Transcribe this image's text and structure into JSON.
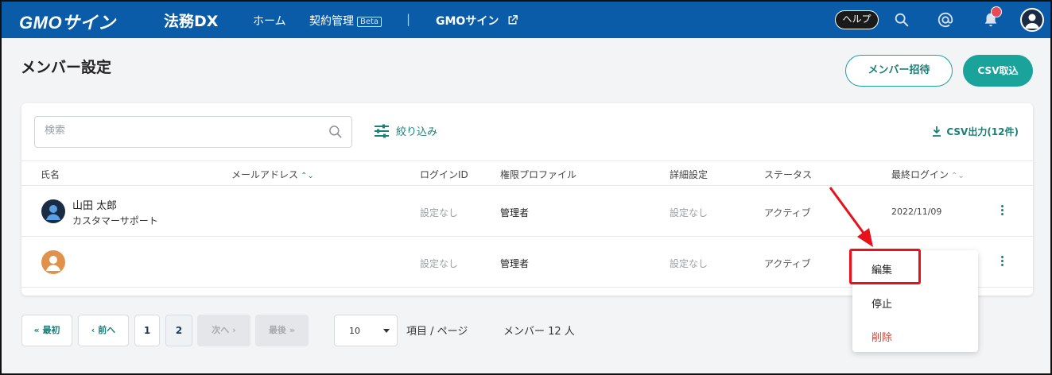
{
  "header": {
    "brand": "GMOサイン",
    "product": "法務DX",
    "nav": [
      {
        "label": "ホーム"
      },
      {
        "label": "契約管理",
        "badge": "Beta"
      },
      {
        "label": "GMOサイン"
      }
    ],
    "separator": "|",
    "help_label": "ヘルプ",
    "icons": [
      "search-icon",
      "at-icon",
      "bell-icon",
      "user-avatar-icon",
      "external-link-icon"
    ],
    "colors": {
      "bar": "#0a5ca8",
      "notification": "#e64b5a"
    }
  },
  "page": {
    "title": "メンバー設定",
    "invite_button": "メンバー招待",
    "csv_import_button": "CSV取込",
    "accent": "#1aa39a"
  },
  "toolbar": {
    "search_placeholder": "検索",
    "filter_label": "絞り込み",
    "csv_export_label": "CSV出力(12件)"
  },
  "table": {
    "columns": [
      "氏名",
      "メールアドレス",
      "ログインID",
      "権限プロファイル",
      "詳細設定",
      "ステータス",
      "最終ログイン"
    ],
    "rows": [
      {
        "name": "山田 太郎",
        "department": "カスタマーサポート",
        "email": "",
        "login_id": "設定なし",
        "profile": "管理者",
        "detail": "設定なし",
        "status": "アクティブ",
        "last_login": "2022/11/09",
        "avatar_color": "#1a2b44"
      },
      {
        "name": "",
        "department": "",
        "email": "",
        "login_id": "設定なし",
        "profile": "管理者",
        "detail": "設定なし",
        "status": "アクティブ",
        "last_login": "",
        "avatar_color": "#e0924a"
      }
    ]
  },
  "context_menu": {
    "items": [
      "編集",
      "停止",
      "削除"
    ],
    "danger_color": "#d2453a",
    "highlight_color": "#e8101a"
  },
  "pagination": {
    "first": "最初",
    "prev": "前へ",
    "pages": [
      "1",
      "2"
    ],
    "current_page": "2",
    "next": "次へ",
    "last": "最後",
    "per_page_value": "10",
    "per_page_label": "項目 / ページ",
    "members_label": "メンバー 12 人"
  }
}
